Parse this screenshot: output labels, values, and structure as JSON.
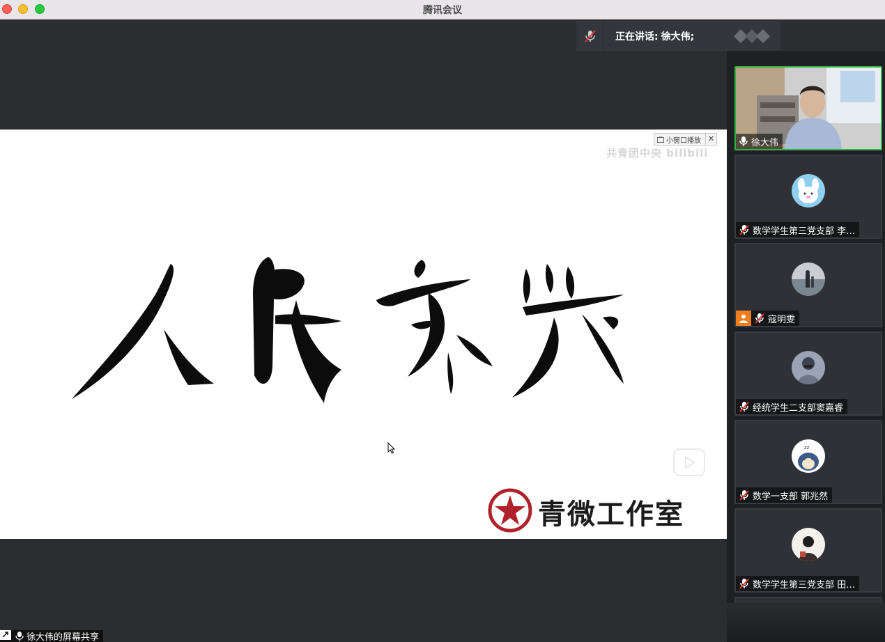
{
  "window": {
    "title": "腾讯会议"
  },
  "speaking": {
    "label": "正在讲话:",
    "name": "徐大伟;"
  },
  "share": {
    "pip_label": "小窗口播放",
    "watermark": "共青团中央  bilibili",
    "studio_name": "青微工作室"
  },
  "participants": [
    {
      "name": "徐大伟",
      "muted": false,
      "active": true,
      "avatar": "video-feed"
    },
    {
      "name": "数学学生第三党支部 李…",
      "muted": true,
      "active": false,
      "avatar": "cartoon-rabbit"
    },
    {
      "name": "寇明雯",
      "muted": true,
      "active": false,
      "avatar": "beach-photo",
      "badge": "user-icon"
    },
    {
      "name": "经统学生二支部窦嘉睿",
      "muted": true,
      "active": false,
      "avatar": "person-photo"
    },
    {
      "name": "数学一支部 郭兆然",
      "muted": true,
      "active": false,
      "avatar": "cartoon-snorlax"
    },
    {
      "name": "数学学生第三党支部 田…",
      "muted": true,
      "active": false,
      "avatar": "person-dark"
    }
  ],
  "bottom": {
    "label": "徐大伟的屏幕共享"
  },
  "colors": {
    "active_border": "#2fb344",
    "muted_red": "#e53935",
    "badge_orange": "#f07e1e"
  }
}
